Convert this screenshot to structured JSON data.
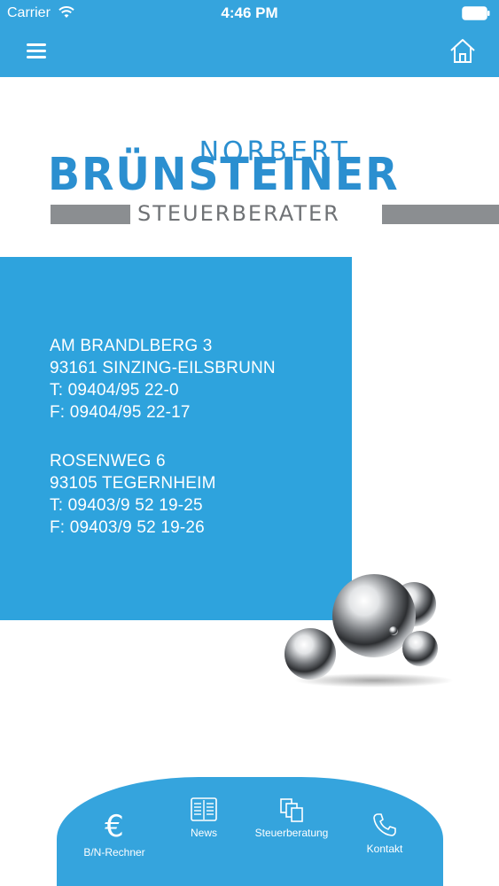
{
  "status_bar": {
    "carrier": "Carrier",
    "time": "4:46 PM",
    "icons": [
      "wifi-icon",
      "battery-icon"
    ]
  },
  "header": {
    "icons": [
      "hamburger-menu-icon",
      "home-icon"
    ],
    "background_color": "#35a4dd"
  },
  "logo": {
    "first_name": "NORBERT",
    "last_name": "BRÜNSTEINER",
    "profession": "STEUERBERATER",
    "blue_color": "#2b8fd0",
    "gray_color": "#8b8e91"
  },
  "addresses": [
    {
      "street": "AM BRANDLBERG 3",
      "city": "93161 SINZING-EILSBRUNN",
      "phone": "T: 09404/95 22-0",
      "fax": "F: 09404/95 22-17"
    },
    {
      "street": "ROSENWEG 6",
      "city": "93105 TEGERNHEIM",
      "phone": "T: 09403/9 52 19-25",
      "fax": "F: 09403/9 52 19-26"
    }
  ],
  "address_panel_color": "#2ea3dd",
  "tab_bar": {
    "tabs": [
      {
        "label": "B/N-Rechner",
        "icon": "euro-icon",
        "glyph": "€"
      },
      {
        "label": "News",
        "icon": "newspaper-icon"
      },
      {
        "label": "Steuerberatung",
        "icon": "documents-icon"
      },
      {
        "label": "Kontakt",
        "icon": "phone-icon"
      }
    ]
  }
}
